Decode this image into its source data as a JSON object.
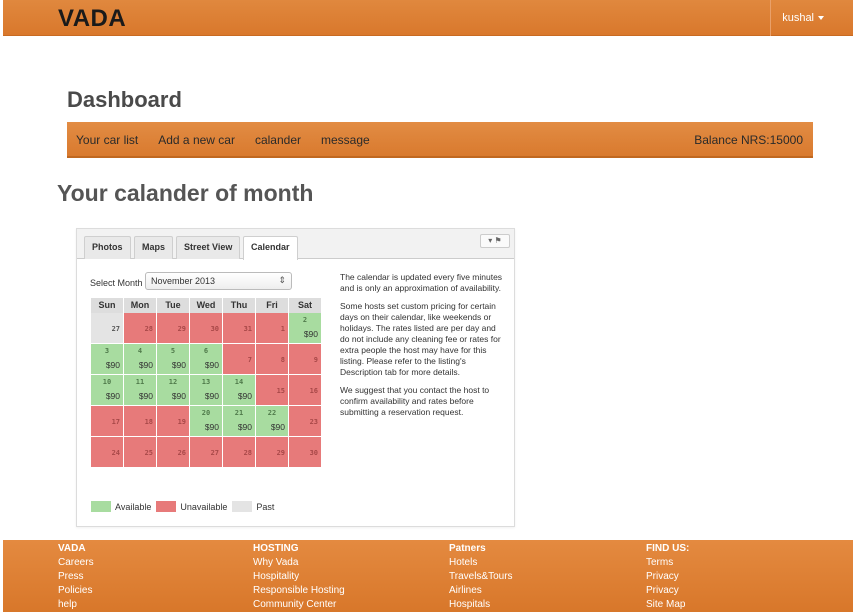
{
  "header": {
    "brand": "VADA",
    "user": "kushal"
  },
  "dashboard": {
    "title": "Dashboard",
    "nav": [
      "Your car list",
      "Add a new car",
      "calander",
      "message"
    ],
    "balance": "Balance NRS:15000"
  },
  "calendar_heading": "Your calander of month",
  "widget": {
    "tabs": [
      "Photos",
      "Maps",
      "Street View",
      "Calendar"
    ],
    "active_tab": "Calendar",
    "select_label": "Select Month",
    "select_value": "November 2013",
    "weekdays": [
      "Sun",
      "Mon",
      "Tue",
      "Wed",
      "Thu",
      "Fri",
      "Sat"
    ],
    "weeks": [
      [
        {
          "d": "27",
          "s": "past"
        },
        {
          "d": "28",
          "s": "unavailable"
        },
        {
          "d": "29",
          "s": "unavailable"
        },
        {
          "d": "30",
          "s": "unavailable"
        },
        {
          "d": "31",
          "s": "unavailable"
        },
        {
          "d": "1",
          "s": "unavailable"
        },
        {
          "d": "2",
          "s": "available",
          "p": "$90"
        }
      ],
      [
        {
          "d": "3",
          "s": "available",
          "p": "$90"
        },
        {
          "d": "4",
          "s": "available",
          "p": "$90"
        },
        {
          "d": "5",
          "s": "available",
          "p": "$90"
        },
        {
          "d": "6",
          "s": "available",
          "p": "$90"
        },
        {
          "d": "7",
          "s": "unavailable"
        },
        {
          "d": "8",
          "s": "unavailable"
        },
        {
          "d": "9",
          "s": "unavailable"
        }
      ],
      [
        {
          "d": "10",
          "s": "available",
          "p": "$90"
        },
        {
          "d": "11",
          "s": "available",
          "p": "$90"
        },
        {
          "d": "12",
          "s": "available",
          "p": "$90"
        },
        {
          "d": "13",
          "s": "available",
          "p": "$90"
        },
        {
          "d": "14",
          "s": "available",
          "p": "$90"
        },
        {
          "d": "15",
          "s": "unavailable"
        },
        {
          "d": "16",
          "s": "unavailable"
        }
      ],
      [
        {
          "d": "17",
          "s": "unavailable"
        },
        {
          "d": "18",
          "s": "unavailable"
        },
        {
          "d": "19",
          "s": "unavailable"
        },
        {
          "d": "20",
          "s": "available",
          "p": "$90"
        },
        {
          "d": "21",
          "s": "available",
          "p": "$90"
        },
        {
          "d": "22",
          "s": "available",
          "p": "$90"
        },
        {
          "d": "23",
          "s": "unavailable"
        }
      ],
      [
        {
          "d": "24",
          "s": "unavailable"
        },
        {
          "d": "25",
          "s": "unavailable"
        },
        {
          "d": "26",
          "s": "unavailable"
        },
        {
          "d": "27",
          "s": "unavailable"
        },
        {
          "d": "28",
          "s": "unavailable"
        },
        {
          "d": "29",
          "s": "unavailable"
        },
        {
          "d": "30",
          "s": "unavailable"
        }
      ]
    ],
    "info": [
      "The calendar is updated every five minutes and is only an approximation of availability.",
      "Some hosts set custom pricing for certain days on their calendar, like weekends or holidays. The rates listed are per day and do not include any cleaning fee or rates for extra people the host may have for this listing. Please refer to the listing's Description tab for more details.",
      "We suggest that you contact the host to confirm availability and rates before submitting a reservation request."
    ],
    "legend": {
      "available": "Available",
      "unavailable": "Unavailable",
      "past": "Past"
    }
  },
  "colors": {
    "available": "#a8dca0",
    "unavailable": "#e77a7a",
    "past": "#e4e4e4",
    "accent": "#dd8034"
  },
  "footer": {
    "columns": [
      {
        "heading": "VADA",
        "links": [
          "Careers",
          "Press",
          "Policies",
          "help"
        ]
      },
      {
        "heading": "HOSTING",
        "links": [
          "Why Vada",
          "Hospitality",
          "Responsible Hosting",
          "Community Center"
        ]
      },
      {
        "heading": "Patners",
        "links": [
          "Hotels",
          "Travels&Tours",
          "Airlines",
          "Hospitals"
        ]
      },
      {
        "heading": "FIND US:",
        "links": [
          "Terms",
          "Privacy",
          "Privacy",
          "Site Map"
        ]
      }
    ]
  }
}
